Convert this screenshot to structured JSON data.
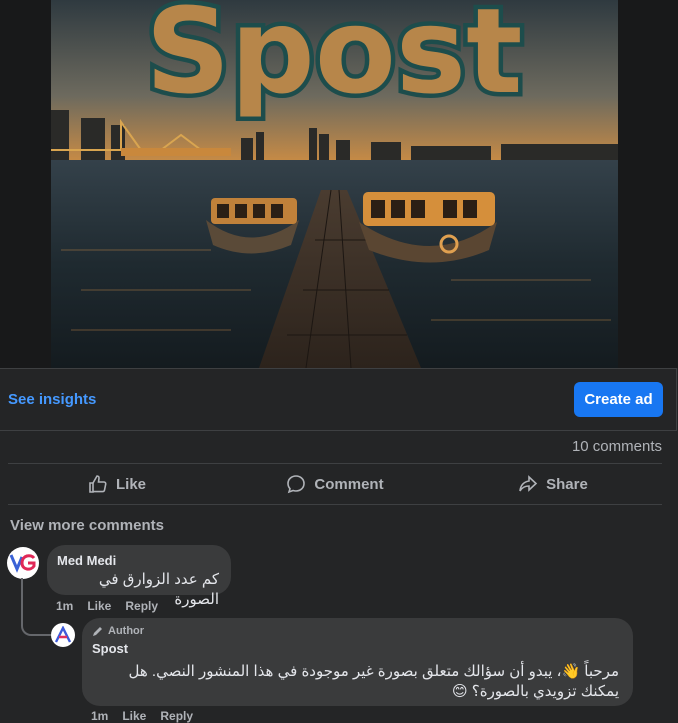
{
  "post": {
    "image_alt": "Spost",
    "image_title_text": "Spost"
  },
  "insights": {
    "see_insights": "See insights",
    "create_ad": "Create ad"
  },
  "stats": {
    "comments_count": "10 comments"
  },
  "actions": {
    "like": "Like",
    "comment": "Comment",
    "share": "Share"
  },
  "comments_section": {
    "view_more": "View more comments",
    "comments": [
      {
        "author": "Med Medi",
        "text": "كم عدد الزوارق في الصورة",
        "time": "1m",
        "like": "Like",
        "reply": "Reply"
      }
    ],
    "replies": [
      {
        "badge": "Author",
        "author": "Spost",
        "text_line1": "مرحباً 👋، يبدو أن سؤالك متعلق بصورة غير موجودة في هذا المنشور النصي. هل",
        "text_line2": "يمكنك تزويدي بالصورة؟ 😊",
        "time": "1m",
        "like": "Like",
        "reply": "Reply"
      }
    ]
  },
  "colors": {
    "background": "#242526",
    "accent": "#1877f2",
    "link": "#4599ff",
    "bubble": "#3a3b3c",
    "muted_text": "#b0b3b8"
  }
}
